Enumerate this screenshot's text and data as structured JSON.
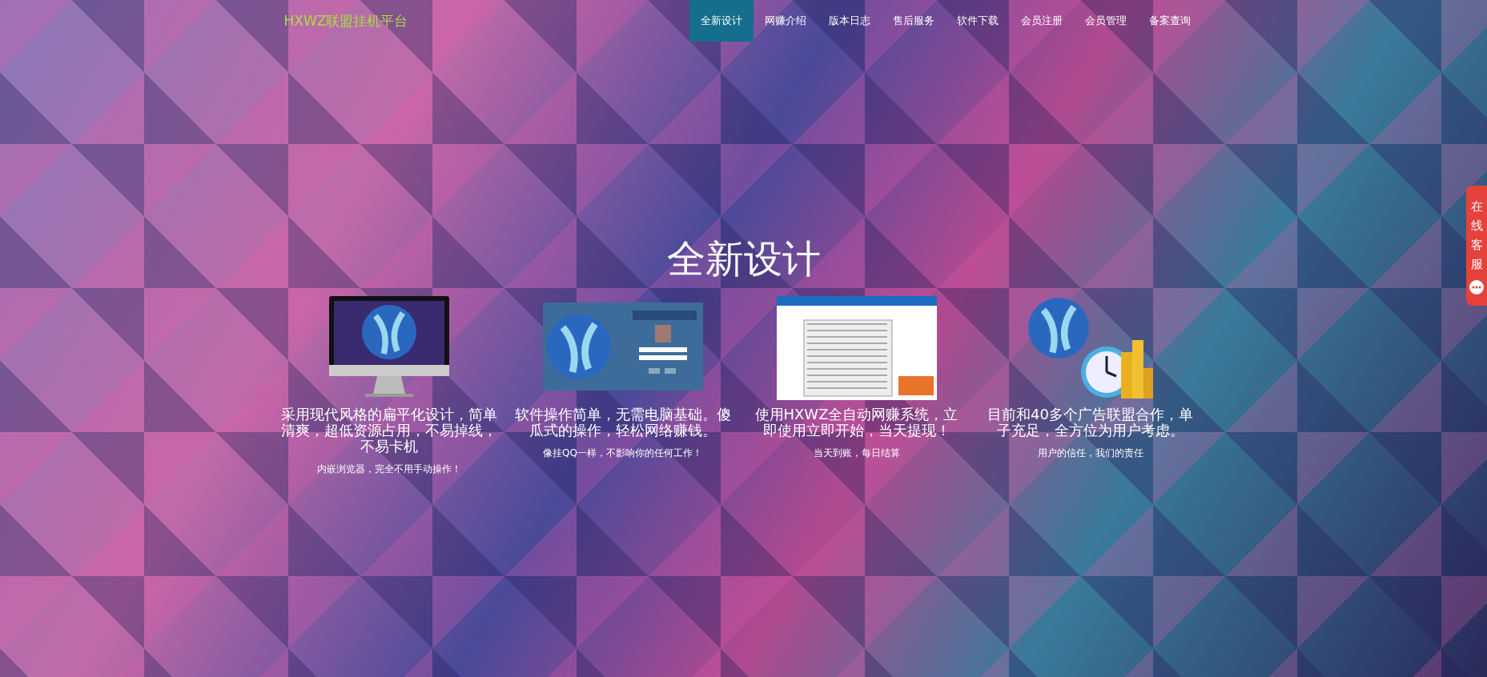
{
  "logo": "HXWZ联盟挂机平台",
  "nav": [
    {
      "label": "全新设计",
      "selected": true
    },
    {
      "label": "网赚介绍",
      "selected": false
    },
    {
      "label": "版本日志",
      "selected": false
    },
    {
      "label": "售后服务",
      "selected": false
    },
    {
      "label": "软件下载",
      "selected": false
    },
    {
      "label": "会员注册",
      "selected": false
    },
    {
      "label": "会员管理",
      "selected": false
    },
    {
      "label": "备案查询",
      "selected": false
    }
  ],
  "title": "全新设计",
  "features": [
    {
      "kind": "monitor",
      "heading": "采用现代风格的扁平化设计，简单清爽，超低资源占用，不易掉线，不易卡机",
      "caption": "内嵌浏览器，完全不用手动操作！"
    },
    {
      "kind": "login",
      "heading": "软件操作简单，无需电脑基础。傻瓜式的操作，轻松网络赚钱。",
      "caption": "像挂QQ一样，不影响你的任何工作！"
    },
    {
      "kind": "app",
      "heading": "使用HXWZ全自动网赚系统，立即使用立即开始，当天提现！",
      "caption": "当天到账，每日结算"
    },
    {
      "kind": "coins",
      "heading": "目前和40多个广告联盟合作，单子充足，全方位为用户考虑。",
      "caption": "用户的信任，我们的责任"
    }
  ],
  "side_tab": {
    "label": "在线客服"
  }
}
